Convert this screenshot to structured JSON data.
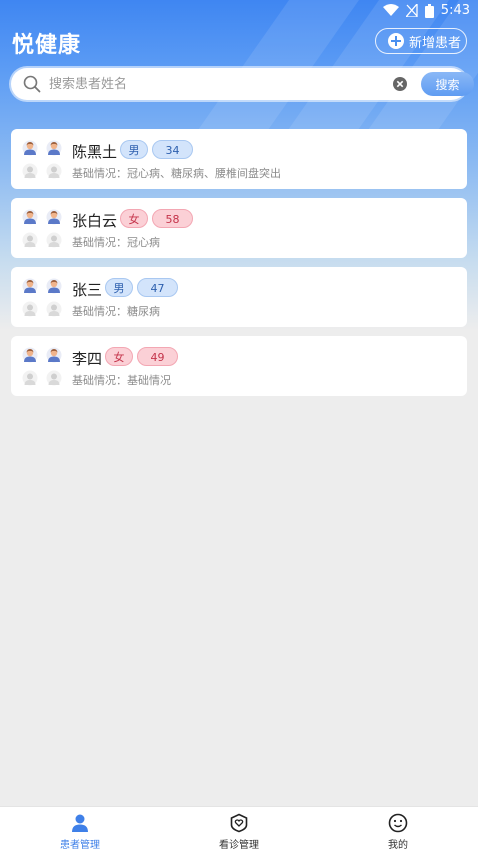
{
  "status_bar": {
    "time": "5:43"
  },
  "header": {
    "title": "悦健康",
    "add_patient_label": "新增患者"
  },
  "search": {
    "placeholder": "搜索患者姓名",
    "button_label": "搜索"
  },
  "patients": [
    {
      "name": "陈黑土",
      "gender": "男",
      "age": "34",
      "basic_info": "基础情况：冠心病、糖尿病、腰椎间盘突出"
    },
    {
      "name": "张白云",
      "gender": "女",
      "age": "58",
      "basic_info": "基础情况：冠心病"
    },
    {
      "name": "张三",
      "gender": "男",
      "age": "47",
      "basic_info": "基础情况：糖尿病"
    },
    {
      "name": "李四",
      "gender": "女",
      "age": "49",
      "basic_info": "基础情况：基础情况"
    }
  ],
  "tabs": [
    {
      "label": "患者管理",
      "icon": "person-icon",
      "active": true
    },
    {
      "label": "看诊管理",
      "icon": "shield-heart-icon",
      "active": false
    },
    {
      "label": "我的",
      "icon": "smile-icon",
      "active": false
    }
  ],
  "colors": {
    "accent": "#3f80e8",
    "male_tag": "#d3e4fb",
    "female_tag": "#fbd0d6"
  }
}
